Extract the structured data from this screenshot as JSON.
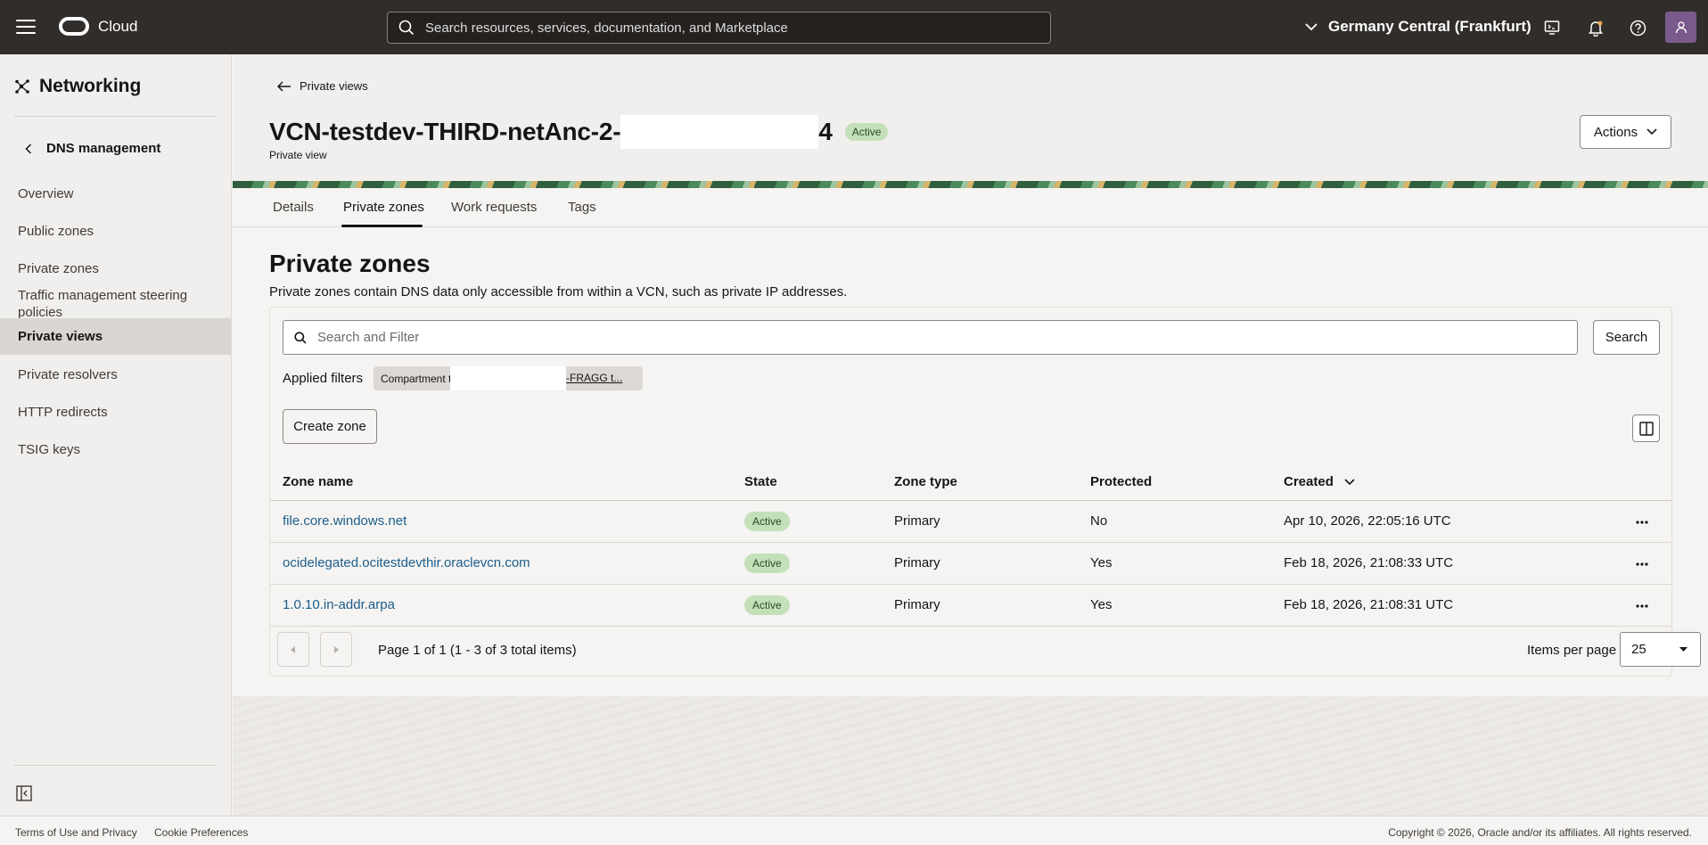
{
  "topbar": {
    "brand": "Cloud",
    "search_placeholder": "Search resources, services, documentation, and Marketplace",
    "region": "Germany Central (Frankfurt)"
  },
  "sidebar": {
    "title": "Networking",
    "back_label": "DNS management",
    "items": [
      {
        "label": "Overview"
      },
      {
        "label": "Public zones"
      },
      {
        "label": "Private zones"
      },
      {
        "label": "Traffic management steering policies"
      },
      {
        "label": "Private views",
        "active": true
      },
      {
        "label": "Private resolvers"
      },
      {
        "label": "HTTP redirects"
      },
      {
        "label": "TSIG keys"
      }
    ]
  },
  "header": {
    "back_link": "Private views",
    "title_prefix": "VCN-testdev-THIRD-netAnc-2-",
    "title_suffix": "4",
    "status": "Active",
    "subtitle": "Private view",
    "actions_label": "Actions"
  },
  "tabs": [
    "Details",
    "Private zones",
    "Work requests",
    "Tags"
  ],
  "section": {
    "title": "Private zones",
    "description": "Private zones contain DNS data only accessible from within a VCN, such as private IP addresses.",
    "filter_placeholder": "Search and Filter",
    "search_button": "Search",
    "applied_filters_label": "Applied filters",
    "filter_chip_prefix": "Compartment t",
    "filter_chip_suffix": "-FRAGG t...",
    "create_button": "Create zone"
  },
  "table": {
    "columns": [
      "Zone name",
      "State",
      "Zone type",
      "Protected",
      "Created"
    ],
    "rows": [
      {
        "name": "file.core.windows.net",
        "state": "Active",
        "type": "Primary",
        "protected": "No",
        "created": "Apr 10, 2026, 22:05:16 UTC"
      },
      {
        "name": "ocidelegated.ocitestdevthir.oraclevcn.com",
        "state": "Active",
        "type": "Primary",
        "protected": "Yes",
        "created": "Feb 18, 2026, 21:08:33 UTC"
      },
      {
        "name": "1.0.10.in-addr.arpa",
        "state": "Active",
        "type": "Primary",
        "protected": "Yes",
        "created": "Feb 18, 2026, 21:08:31 UTC"
      }
    ]
  },
  "pagination": {
    "page_text": "Page 1 of 1 (1 - 3 of 3 total items)",
    "items_per_page_label": "Items per page",
    "items_per_page_value": "25"
  },
  "footer": {
    "terms": "Terms of Use and Privacy",
    "cookies": "Cookie Preferences",
    "copyright": "Copyright © 2026, Oracle and/or its affiliates. All rights reserved."
  }
}
